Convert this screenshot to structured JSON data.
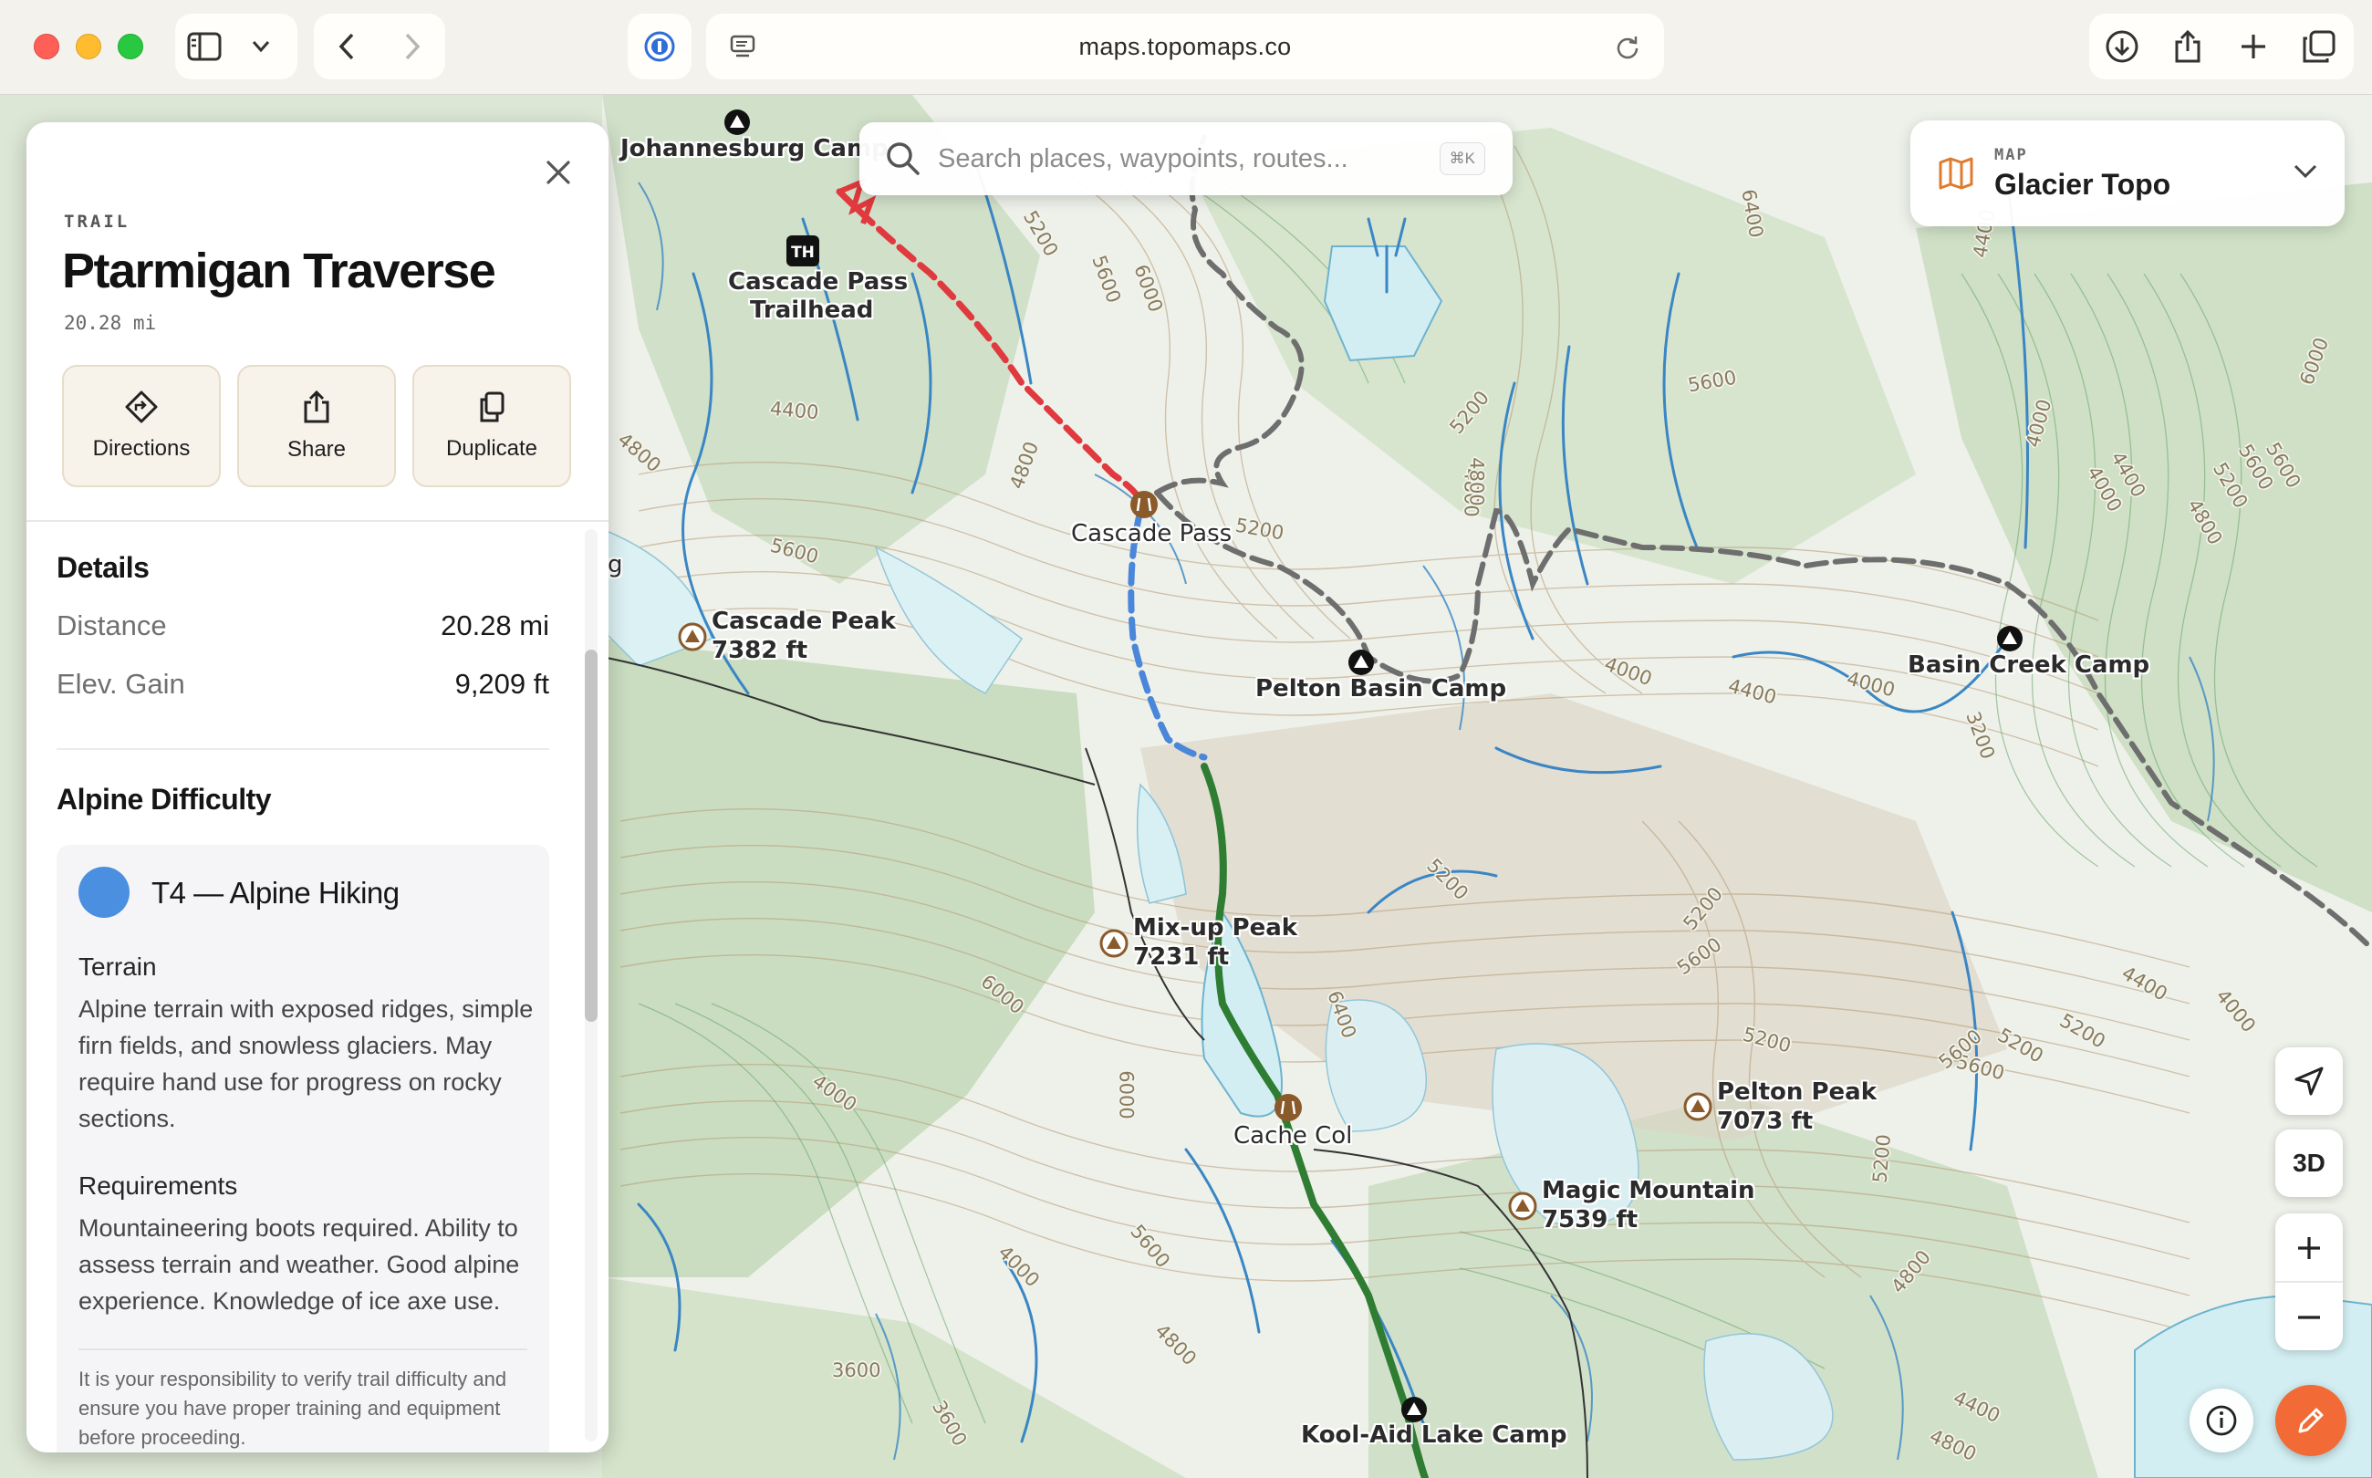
{
  "browser": {
    "url": "maps.topomaps.co"
  },
  "search": {
    "placeholder": "Search places, waypoints, routes...",
    "shortcut": "⌘K"
  },
  "layer_selector": {
    "caption": "MAP",
    "name": "Glacier Topo"
  },
  "panel": {
    "type": "TRAIL",
    "title": "Ptarmigan Traverse",
    "distance": "20.28 mi",
    "actions": [
      "Directions",
      "Share",
      "Duplicate"
    ],
    "details": {
      "heading": "Details",
      "rows": [
        {
          "label": "Distance",
          "value": "20.28 mi"
        },
        {
          "label": "Elev. Gain",
          "value": "9,209 ft"
        }
      ]
    },
    "difficulty": {
      "heading": "Alpine Difficulty",
      "level": "T4 — Alpine Hiking",
      "color": "#4a8fe0",
      "terrain_heading": "Terrain",
      "terrain_text": "Alpine terrain with exposed ridges, simple firn fields, and snowless glaciers. May require hand use for progress on rocky sections.",
      "requirements_heading": "Requirements",
      "requirements_text": "Mountaineering boots required. Ability to assess terrain and weather. Good alpine experience. Knowledge of ice axe use.",
      "disclaimer": "It is your responsibility to verify trail difficulty and ensure you have proper training and equipment before proceeding."
    }
  },
  "map": {
    "labels": {
      "johannesburg_camp": "Johannesburg Camp",
      "cascade_pass_trailhead_1": "Cascade Pass",
      "cascade_pass_trailhead_2": "Trailhead",
      "th_badge": "TH",
      "cascade_pass": "Cascade Pass",
      "cascade_peak": "Cascade Peak",
      "cascade_peak_elev": "7382 ft",
      "pelton_basin_camp": "Pelton Basin Camp",
      "basin_creek_camp": "Basin Creek Camp",
      "mixup_peak": "Mix-up Peak",
      "mixup_peak_elev": "7231 ft",
      "cache_col": "Cache Col",
      "pelton_peak": "Pelton Peak",
      "pelton_peak_elev": "7073 ft",
      "magic_mountain": "Magic Mountain",
      "magic_mountain_elev": "7539 ft",
      "kool_aid_lake_camp": "Kool-Aid Lake Camp",
      "edge_g": "g"
    },
    "contours": [
      "6400",
      "4400",
      "5200",
      "5600",
      "6000",
      "5600",
      "5200",
      "4400",
      "4800",
      "5600",
      "4800",
      "5200",
      "4800",
      "4000",
      "4000",
      "4400",
      "4000",
      "3200",
      "5200",
      "5200",
      "5600",
      "6000",
      "6400",
      "4000",
      "6000",
      "5600",
      "4000",
      "4800",
      "3600",
      "3600",
      "5200",
      "4800",
      "4400",
      "4800",
      "5600",
      "5200",
      "5600",
      "4400",
      "5200",
      "4000",
      "4800",
      "4400",
      "5200",
      "5600",
      "4000",
      "5200",
      "6000",
      "5600",
      "4800"
    ],
    "controls": {
      "three_d": "3D"
    },
    "colors": {
      "route_red": "#e0393e",
      "route_blue": "#4a86d9",
      "route_green": "#2e7d32",
      "trail_gray": "#6e6e6e",
      "water": "#d6eff3",
      "stream": "#3a86c4",
      "accent_orange": "#f26a35"
    }
  },
  "icons": [
    "sidebar-toggle-icon",
    "chevron-down-icon",
    "back-icon",
    "forward-icon",
    "password-icon",
    "reader-icon",
    "reload-icon",
    "download-icon",
    "share-icon",
    "new-tab-icon",
    "tabs-overview-icon",
    "search-icon",
    "map-icon",
    "close-icon",
    "directions-icon",
    "share-icon",
    "duplicate-icon",
    "locate-icon",
    "plus-icon",
    "minus-icon",
    "info-icon",
    "pencil-icon",
    "camp-icon",
    "peak-icon",
    "pass-icon",
    "trailhead-icon"
  ]
}
